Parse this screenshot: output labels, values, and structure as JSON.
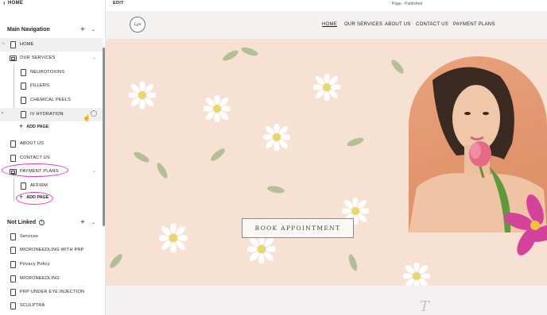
{
  "sidebar": {
    "home_link": "HOME",
    "main_nav_title": "Main Navigation",
    "main_items": [
      {
        "label": "HOME"
      },
      {
        "label": "OUR SERVICES"
      },
      {
        "label": "NEUROTOXINS"
      },
      {
        "label": "FILLERS"
      },
      {
        "label": "CHEMICAL PEELS"
      },
      {
        "label": "IV HYDRATION"
      },
      {
        "label": "ADD PAGE"
      },
      {
        "label": "ABOUT US"
      },
      {
        "label": "CONTACT US"
      },
      {
        "label": "PAYMENT PLANS"
      },
      {
        "label": "AFFIRM"
      },
      {
        "label": "ADD PAGE"
      }
    ],
    "not_linked_title": "Not Linked",
    "not_linked_items": [
      {
        "label": "Services"
      },
      {
        "label": "MICRONEEDLING WITH PRP"
      },
      {
        "label": "Privacy Policy"
      },
      {
        "label": "MICRONEEDLING"
      },
      {
        "label": "PRP UNDER EYE INJECTION"
      },
      {
        "label": "SCULPTRA"
      }
    ]
  },
  "editor": {
    "edit_label": "EDIT",
    "page_status": "Page · Published"
  },
  "site": {
    "logo_text": "Lyn",
    "nav": [
      "HOME",
      "OUR SERVICES",
      "ABOUT US",
      "CONTACT US",
      "PAYMENT PLANS"
    ],
    "cta_label": "BOOK APPOINTMENT",
    "script_text": "T"
  },
  "colors": {
    "highlight": "#d63cd6",
    "hero_bg": "#f6e1d3",
    "arch_bg": "#e59b73"
  }
}
